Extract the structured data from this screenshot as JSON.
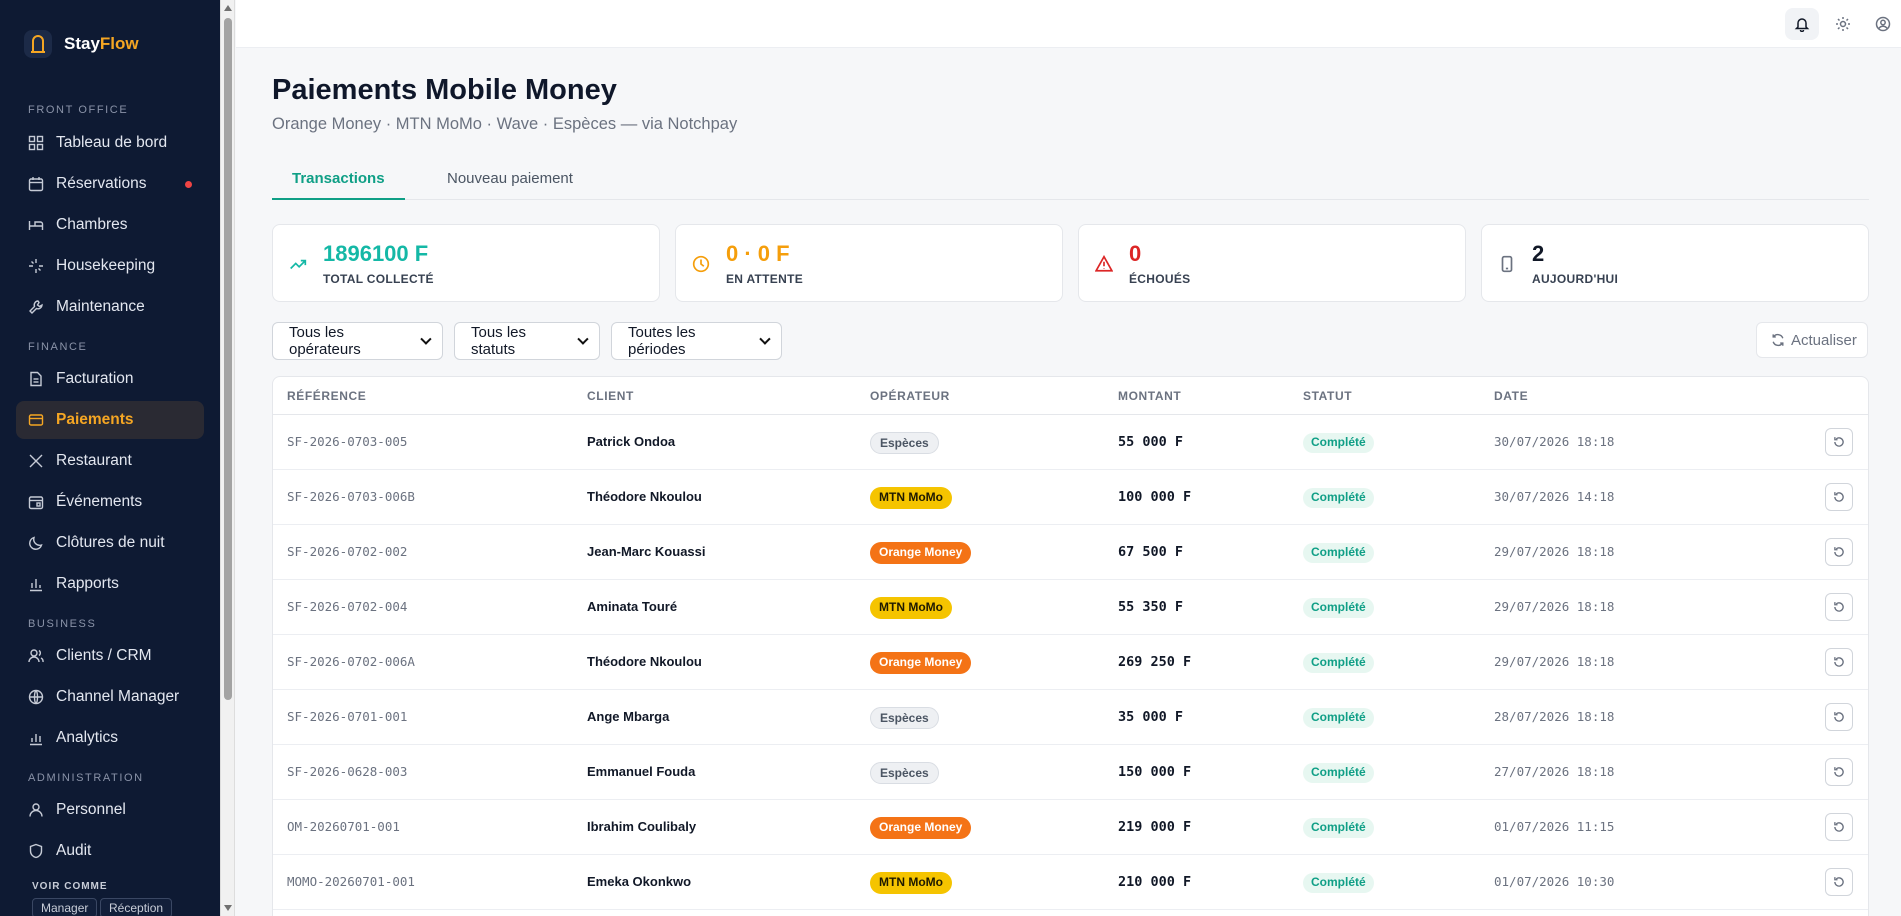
{
  "brand": {
    "name_part1": "Stay",
    "name_part2": "Flow",
    "accent": "#f5a623"
  },
  "sidebar": {
    "sections": {
      "front_office": "FRONT OFFICE",
      "finance": "FINANCE",
      "business": "BUSINESS",
      "administration": "ADMINISTRATION"
    },
    "items": [
      {
        "label": "Tableau de bord",
        "icon": "grid-icon"
      },
      {
        "label": "Réservations",
        "icon": "calendar-icon",
        "notification": true
      },
      {
        "label": "Chambres",
        "icon": "bed-icon"
      },
      {
        "label": "Housekeeping",
        "icon": "sparkles-icon"
      },
      {
        "label": "Maintenance",
        "icon": "wrench-icon"
      },
      {
        "label": "Facturation",
        "icon": "file-icon"
      },
      {
        "label": "Paiements",
        "icon": "credit-card-icon",
        "active": true
      },
      {
        "label": "Restaurant",
        "icon": "utensils-icon"
      },
      {
        "label": "Événements",
        "icon": "calendar-event-icon"
      },
      {
        "label": "Clôtures de nuit",
        "icon": "moon-icon"
      },
      {
        "label": "Rapports",
        "icon": "bar-chart-icon"
      },
      {
        "label": "Clients / CRM",
        "icon": "users-icon"
      },
      {
        "label": "Channel Manager",
        "icon": "globe-icon"
      },
      {
        "label": "Analytics",
        "icon": "analytics-icon"
      },
      {
        "label": "Personnel",
        "icon": "user-icon"
      },
      {
        "label": "Audit",
        "icon": "shield-icon"
      }
    ],
    "voir_comme": "VOIR COMME",
    "roles": [
      "Manager",
      "Réception"
    ]
  },
  "header": {
    "title": "Paiements Mobile Money",
    "subtitle": "Orange Money · MTN MoMo · Wave · Espèces — via Notchpay"
  },
  "tabs": [
    "Transactions",
    "Nouveau paiement"
  ],
  "stats": [
    {
      "value": "1896100 F",
      "label": "TOTAL COLLECTÉ",
      "color": "#14b8a6",
      "icon": "trending-up-icon"
    },
    {
      "value": "0 · 0 F",
      "label": "EN ATTENTE",
      "color": "#f59e0b",
      "icon": "clock-icon"
    },
    {
      "value": "0",
      "label": "ÉCHOUÉS",
      "color": "#dc2626",
      "icon": "alert-triangle-icon"
    },
    {
      "value": "2",
      "label": "AUJOURD'HUI",
      "color": "#111827",
      "icon": "phone-icon"
    }
  ],
  "filters": [
    "Tous les opérateurs",
    "Tous les statuts",
    "Toutes les périodes"
  ],
  "refresh_label": "Actualiser",
  "table": {
    "headers": [
      "RÉFÉRENCE",
      "CLIENT",
      "OPÉRATEUR",
      "MONTANT",
      "STATUT",
      "DATE"
    ],
    "rows": [
      {
        "ref": "SF-2026-0703-005",
        "client": "Patrick Ondoa",
        "operator": "Espèces",
        "op_type": "especes",
        "amount": "55 000 F",
        "status": "Complété",
        "date": "30/07/2026 18:18"
      },
      {
        "ref": "SF-2026-0703-006B",
        "client": "Théodore Nkoulou",
        "operator": "MTN MoMo",
        "op_type": "mtn",
        "amount": "100 000 F",
        "status": "Complété",
        "date": "30/07/2026 14:18"
      },
      {
        "ref": "SF-2026-0702-002",
        "client": "Jean-Marc Kouassi",
        "operator": "Orange Money",
        "op_type": "orange",
        "amount": "67 500 F",
        "status": "Complété",
        "date": "29/07/2026 18:18"
      },
      {
        "ref": "SF-2026-0702-004",
        "client": "Aminata Touré",
        "operator": "MTN MoMo",
        "op_type": "mtn",
        "amount": "55 350 F",
        "status": "Complété",
        "date": "29/07/2026 18:18"
      },
      {
        "ref": "SF-2026-0702-006A",
        "client": "Théodore Nkoulou",
        "operator": "Orange Money",
        "op_type": "orange",
        "amount": "269 250 F",
        "status": "Complété",
        "date": "29/07/2026 18:18"
      },
      {
        "ref": "SF-2026-0701-001",
        "client": "Ange Mbarga",
        "operator": "Espèces",
        "op_type": "especes",
        "amount": "35 000 F",
        "status": "Complété",
        "date": "28/07/2026 18:18"
      },
      {
        "ref": "SF-2026-0628-003",
        "client": "Emmanuel Fouda",
        "operator": "Espèces",
        "op_type": "especes",
        "amount": "150 000 F",
        "status": "Complété",
        "date": "27/07/2026 18:18"
      },
      {
        "ref": "OM-20260701-001",
        "client": "Ibrahim Coulibaly",
        "operator": "Orange Money",
        "op_type": "orange",
        "amount": "219 000 F",
        "status": "Complété",
        "date": "01/07/2026 11:15"
      },
      {
        "ref": "MOMO-20260701-001",
        "client": "Emeka Okonkwo",
        "operator": "MTN MoMo",
        "op_type": "mtn",
        "amount": "210 000 F",
        "status": "Complété",
        "date": "01/07/2026 10:30"
      }
    ]
  }
}
